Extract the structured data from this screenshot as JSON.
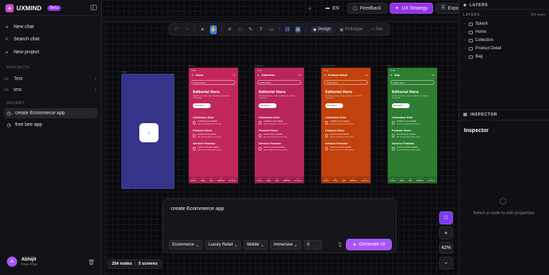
{
  "brand": {
    "name": "UXMIND",
    "badge": "Beta"
  },
  "sidebar": {
    "nav": [
      {
        "icon": "+",
        "label": "New chat"
      },
      {
        "icon": "⌕",
        "label": "Search chat"
      },
      {
        "icon": "+",
        "label": "New project"
      }
    ],
    "projects_heading": "PROJECTS",
    "projects": [
      {
        "label": "Test"
      },
      {
        "label": "test"
      }
    ],
    "recent_heading": "RECENT",
    "recent": [
      {
        "label": "create Ecommerce app",
        "active": true
      },
      {
        "label": "free bee app",
        "active": false
      }
    ],
    "user": {
      "initial": "A",
      "name": "Abhijit",
      "plan": "Free Plan"
    }
  },
  "topbar": {
    "language": "EN",
    "feedback": "Feedback",
    "ux_strategy": "UX Strategy",
    "export": "Export UI"
  },
  "toolbar": {
    "modes": [
      "Design",
      "Prototype",
      "Dev"
    ],
    "active_mode": "Design"
  },
  "frames": {
    "splash": {
      "color": "#34348a"
    },
    "screens": [
      {
        "label": "Home",
        "color": "#c2275b"
      },
      {
        "label": "Collection",
        "color": "#b8255a"
      },
      {
        "label": "Product Detail",
        "color": "#c2410c"
      },
      {
        "label": "Bag",
        "color": "#2e7d32"
      }
    ],
    "status_time": "9:41",
    "search_placeholder": "Enter text...",
    "hero_title": "Editorial Hero",
    "hero_sub": "Premium prices, clear reviews, and fresh moments",
    "hero_button": "Get Started",
    "sections": [
      "Collection Grid",
      "Product Story",
      "Service Promise"
    ],
    "rows": [
      {
        "title": "collection grid update",
        "sub": "Recommended next action"
      },
      {
        "title": "product story update",
        "sub": "Recommended next action"
      },
      {
        "title": "service promise update",
        "sub": "Recommended next action"
      }
    ],
    "tabs": [
      "Home",
      "Shop",
      "Sell",
      "Wishlist",
      "Account"
    ]
  },
  "prompt": {
    "text": "create Ecommerce app",
    "chips": [
      "Ecommerce",
      "Luxury Retail",
      "Mobile",
      "Immersive"
    ],
    "count": "5",
    "generate": "Generate UI"
  },
  "zoom": {
    "level": "42%"
  },
  "footer": {
    "nodes": "254 nodes",
    "screens": "5 screens"
  },
  "layers_panel": {
    "heading": "LAYERS",
    "sub_label": "LAYERS",
    "count": "254 items",
    "items": [
      "Splash",
      "Home",
      "Collection",
      "Product Detail",
      "Bag"
    ]
  },
  "inspector": {
    "heading": "INSPECTOR",
    "title": "Inspector",
    "empty": "Select a node to edit properties"
  },
  "colors": {
    "accent": "#a855f7",
    "active_tool": "#3b82f6"
  }
}
